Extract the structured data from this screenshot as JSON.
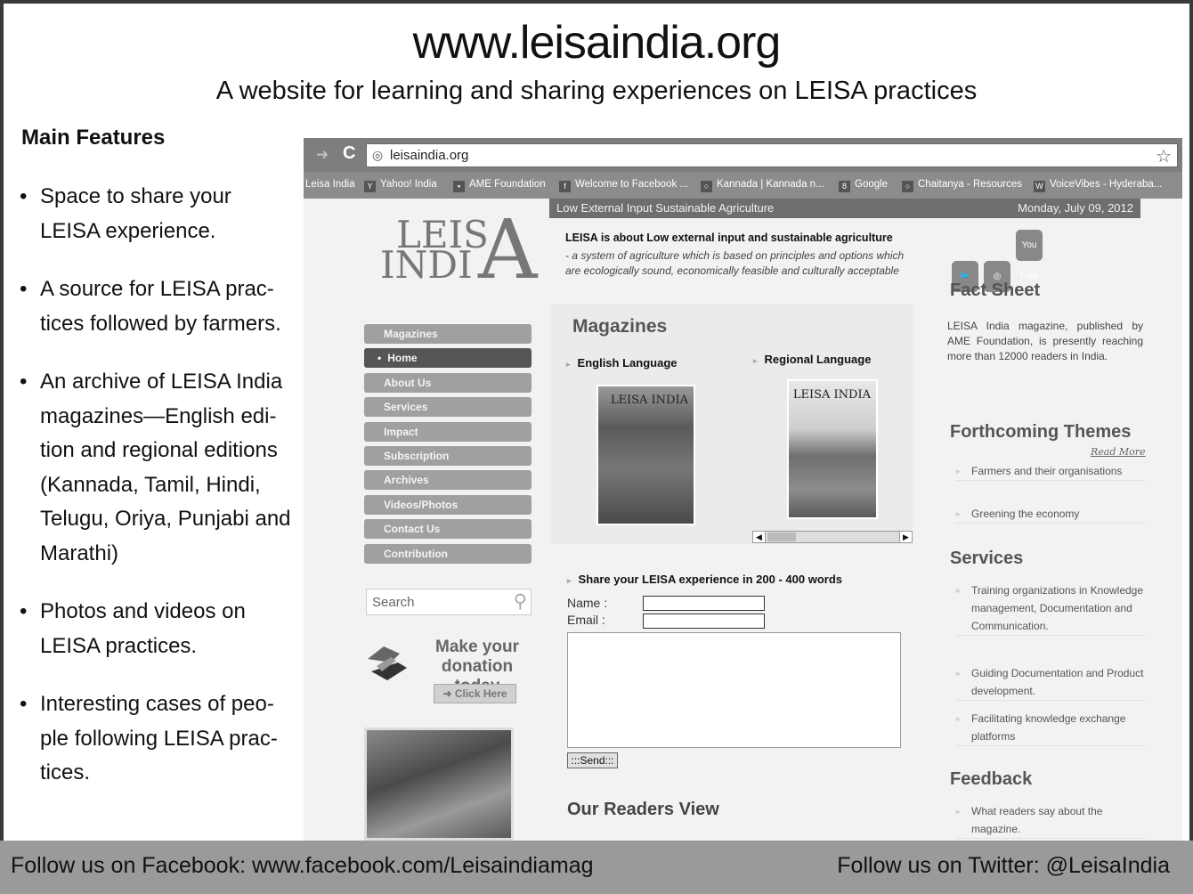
{
  "header": {
    "site_title": "www.leisaindia.org",
    "tagline": "A website for learning and sharing experiences on LEISA practices"
  },
  "features": {
    "heading": "Main Features",
    "items": [
      "Space to share your LEISA experience.",
      "A source for LEISA prac-tices followed by farmers.",
      "An archive of LEISA India magazines—English edi-tion and regional editions (Kannada, Tamil, Hindi, Telugu, Oriya, Punjabi and Marathi)",
      "Photos and videos on LEISA practices.",
      "Interesting cases of peo-ple following LEISA prac-tices."
    ]
  },
  "browser": {
    "url": "leisaindia.org",
    "bookmarks": [
      "Leisa India",
      "Yahoo! India",
      "AME Foundation",
      "Welcome to Facebook ...",
      "Kannada | Kannada n...",
      "Google",
      "Chaitanya - Resources",
      "VoiceVibes - Hyderaba..."
    ]
  },
  "site": {
    "logo_top": "LEIS",
    "logo_bottom": "INDI",
    "logo_big": "A",
    "topbar_left": "Low External Input Sustainable Agriculture",
    "topbar_right": "Monday, July 09, 2012",
    "about_heading": "LEISA is about Low external input and sustainable agriculture",
    "about_text": "- a system of agriculture which is based on principles and options which are ecologically sound, economically feasible and culturally acceptable",
    "menu": [
      "Magazines",
      "Home",
      "About Us",
      "Services",
      "Impact",
      "Subscription",
      "Archives",
      "Videos/Photos",
      "Contact Us",
      "Contribution"
    ],
    "search_placeholder": "Search",
    "donate_text": "Make your donation today",
    "click_here": "Click Here",
    "magazines_heading": "Magazines",
    "english_language": "English Language",
    "regional_language": "Regional Language",
    "cover_title": "LEISA INDIA",
    "share_heading": "Share your LEISA experience in 200 - 400 words",
    "name_label": "Name :",
    "email_label": "Email :",
    "send_label": ":::Send:::",
    "readers_heading": "Our Readers View",
    "social_icons": [
      "twitter-icon",
      "blogger-icon",
      "youtube-icon"
    ],
    "youtube_label": "You Tube",
    "fact_sheet_heading": "Fact Sheet",
    "fact_sheet_text": "LEISA India magazine, published by AME Foundation, is presently reaching more than 12000 readers in India.",
    "read_more": "Read More",
    "themes_heading": "Forthcoming Themes",
    "themes": [
      "Farmers and their organisations",
      "Greening the economy"
    ],
    "services_heading": "Services",
    "services": [
      "Training organizations in Knowledge management, Documentation and Communication.",
      "Guiding Documentation and Product development.",
      "Facilitating knowledge exchange platforms"
    ],
    "feedback_heading": "Feedback",
    "feedback_items": [
      "What readers say about the magazine."
    ]
  },
  "footer": {
    "facebook": "Follow us on Facebook: www.facebook.com/Leisaindiamag",
    "twitter": "Follow us on Twitter: @LeisaIndia"
  }
}
